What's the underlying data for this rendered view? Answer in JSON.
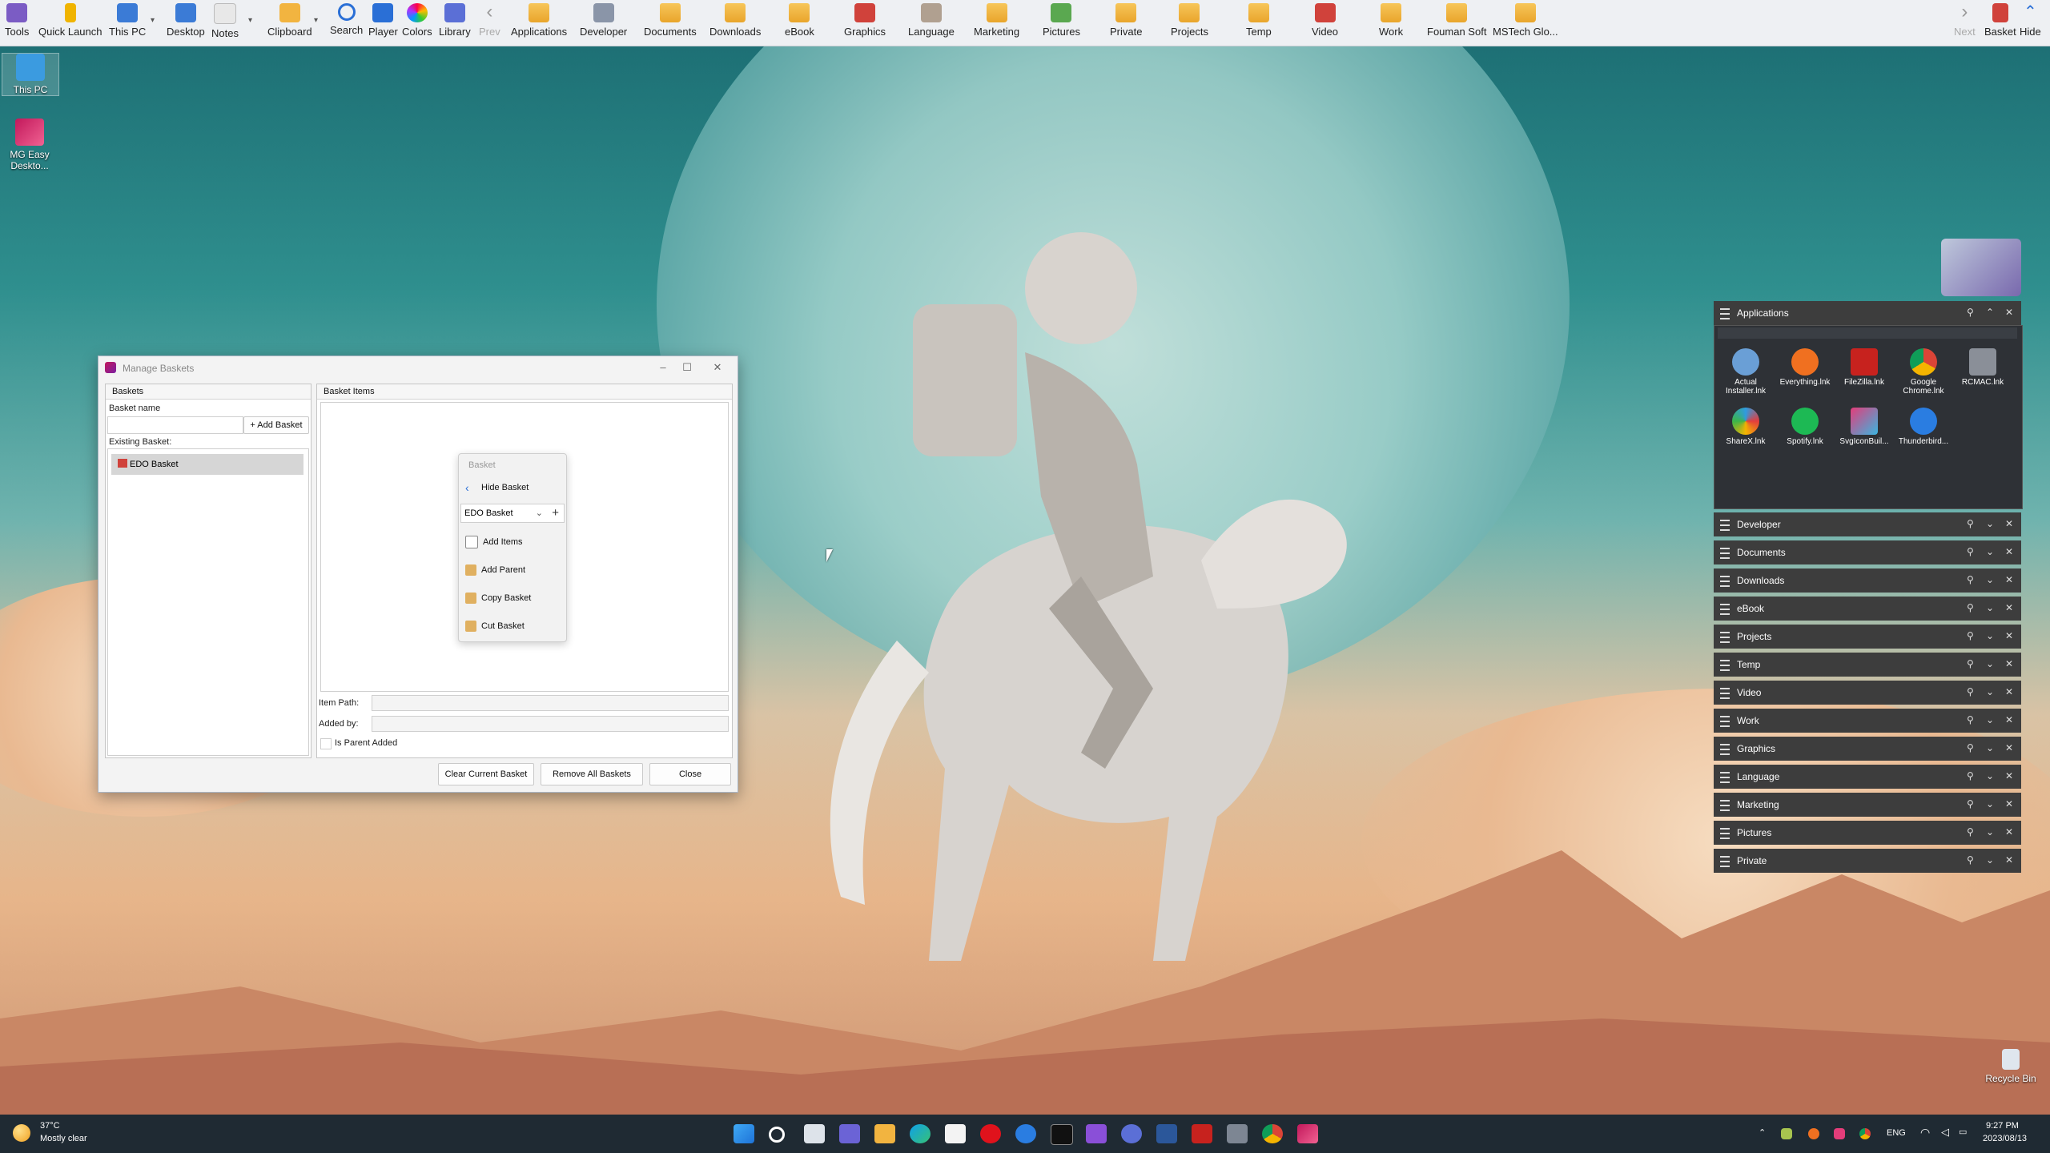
{
  "toolbar": {
    "items": [
      {
        "label": "Tools",
        "color": "#7b5cc4"
      },
      {
        "label": "Quick Launch",
        "color": "#f0b400"
      },
      {
        "label": "This PC",
        "color": "#3b7bd6"
      },
      {
        "label": "Desktop",
        "color": "#3b7bd6"
      },
      {
        "label": "Notes",
        "color": "#e3e3e3"
      },
      {
        "label": "Clipboard",
        "color": "#f2b440"
      },
      {
        "label": "Search",
        "color": "#2a6fd6"
      },
      {
        "label": "Player",
        "color": "#2a6fd6"
      },
      {
        "label": "Colors",
        "color": "#d45cf0"
      },
      {
        "label": "Library",
        "color": "#5b6fd6"
      },
      {
        "label": "Prev",
        "color": "#9a9a9a"
      },
      {
        "label": "Applications",
        "color": "#f2b440"
      },
      {
        "label": "Developer",
        "color": "#8a95a8"
      },
      {
        "label": "Documents",
        "color": "#f2b440"
      },
      {
        "label": "Downloads",
        "color": "#f2b440"
      },
      {
        "label": "eBook",
        "color": "#f2b440"
      },
      {
        "label": "Graphics",
        "color": "#d0423b"
      },
      {
        "label": "Language",
        "color": "#b0a090"
      },
      {
        "label": "Marketing",
        "color": "#f2b440"
      },
      {
        "label": "Pictures",
        "color": "#5aa850"
      },
      {
        "label": "Private",
        "color": "#f2b440"
      },
      {
        "label": "Projects",
        "color": "#f2b440"
      },
      {
        "label": "Temp",
        "color": "#f2b440"
      },
      {
        "label": "Video",
        "color": "#d0423b"
      },
      {
        "label": "Work",
        "color": "#f2b440"
      },
      {
        "label": "Fouman Soft",
        "color": "#f2b440"
      },
      {
        "label": "MSTech Glo...",
        "color": "#f2b440"
      }
    ],
    "right": {
      "next": "Next",
      "basket": "Basket",
      "hide": "Hide"
    }
  },
  "desktop": {
    "icons": [
      {
        "label": "This PC"
      },
      {
        "label": "MG Easy Deskto..."
      }
    ],
    "recycle": "Recycle Bin"
  },
  "window": {
    "title": "Manage Baskets",
    "baskets_header": "Baskets",
    "basket_name_label": "Basket name",
    "add_basket": "Add Basket",
    "existing_label": "Existing Basket:",
    "existing_items": [
      "EDO Basket"
    ],
    "items_header": "Basket Items",
    "item_path_label": "Item Path:",
    "added_by_label": "Added by:",
    "is_parent_label": "Is Parent Added",
    "buttons": {
      "clear": "Clear Current Basket",
      "remove": "Remove All Baskets",
      "close": "Close"
    }
  },
  "menu": {
    "header": "Basket",
    "hide": "Hide Basket",
    "selected": "EDO Basket",
    "items": [
      "Add Items",
      "Add Parent",
      "Copy Basket",
      "Cut Basket"
    ]
  },
  "right_panels": {
    "applications": "Applications",
    "apps": [
      {
        "label": "Actual Installer.lnk",
        "color": "#6a9fd6"
      },
      {
        "label": "Everything.lnk",
        "color": "#f07020"
      },
      {
        "label": "FileZilla.lnk",
        "color": "#c7221e"
      },
      {
        "label": "Google Chrome.lnk",
        "color": "#e8b70b"
      },
      {
        "label": "RCMAC.lnk",
        "color": "#8a8f98"
      },
      {
        "label": "ShareX.lnk",
        "color": "#2f9be0"
      },
      {
        "label": "Spotify.lnk",
        "color": "#1db954"
      },
      {
        "label": "SvgIconBuil...",
        "color": "#e33d7a"
      },
      {
        "label": "Thunderbird...",
        "color": "#2a7de1"
      }
    ],
    "others": [
      "Developer",
      "Documents",
      "Downloads",
      "eBook",
      "Projects",
      "Temp",
      "Video",
      "Work",
      "Graphics",
      "Language",
      "Marketing",
      "Pictures",
      "Private"
    ]
  },
  "taskbar": {
    "weather_temp": "37°C",
    "weather_desc": "Mostly clear",
    "lang": "ENG",
    "time": "9:27 PM",
    "date": "2023/08/13"
  }
}
